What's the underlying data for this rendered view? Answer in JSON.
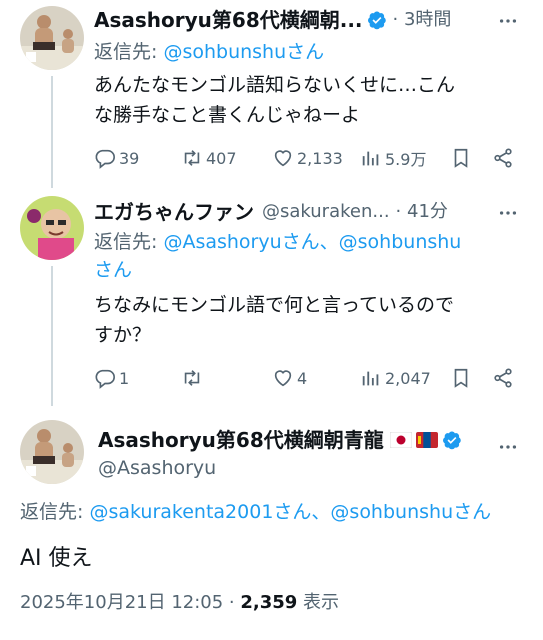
{
  "tweet1": {
    "display_name": "Asashoryu第68代横綱朝...",
    "time": "· 3時間",
    "reply_prefix": "返信先: ",
    "reply_to": "@sohbunshuさん",
    "text_line1": "あんたなモンゴル語知らないくせに…こん",
    "text_line2": "な勝手なこと書くんじゃねーよ",
    "replies": "39",
    "reposts": "407",
    "likes": "2,133",
    "views": "5.9万"
  },
  "tweet2": {
    "display_name": "エガちゃんファン",
    "handle": "@sakuraken...",
    "time": "· 41分",
    "reply_prefix": "返信先: ",
    "reply_to_line1": "@Asashoryuさん、@sohbunshu",
    "reply_to_line2": "さん",
    "text_line1": "ちなみにモンゴル語で何と言っているので",
    "text_line2": "すか？",
    "replies": "1",
    "likes": "4",
    "views": "2,047"
  },
  "tweet3": {
    "display_name": "Asashoryu第68代横綱朝青龍",
    "handle": "@Asashoryu",
    "reply_prefix": "返信先: ",
    "reply_to": "@sakurakenta2001さん、@sohbunshuさん",
    "text": "AI 使え",
    "timestamp": "2025年10月21日 12:05 · ",
    "view_count": "2,359",
    "view_label": " 表示"
  },
  "colors": {
    "accent": "#1d9bf0",
    "secondary_text": "#536471",
    "primary_text": "#0f1419"
  },
  "icons": [
    "verified-badge-icon",
    "more-icon",
    "reply-icon",
    "repost-icon",
    "like-icon",
    "views-icon",
    "bookmark-icon",
    "share-icon",
    "japan-flag-icon",
    "mongolia-flag-icon"
  ]
}
